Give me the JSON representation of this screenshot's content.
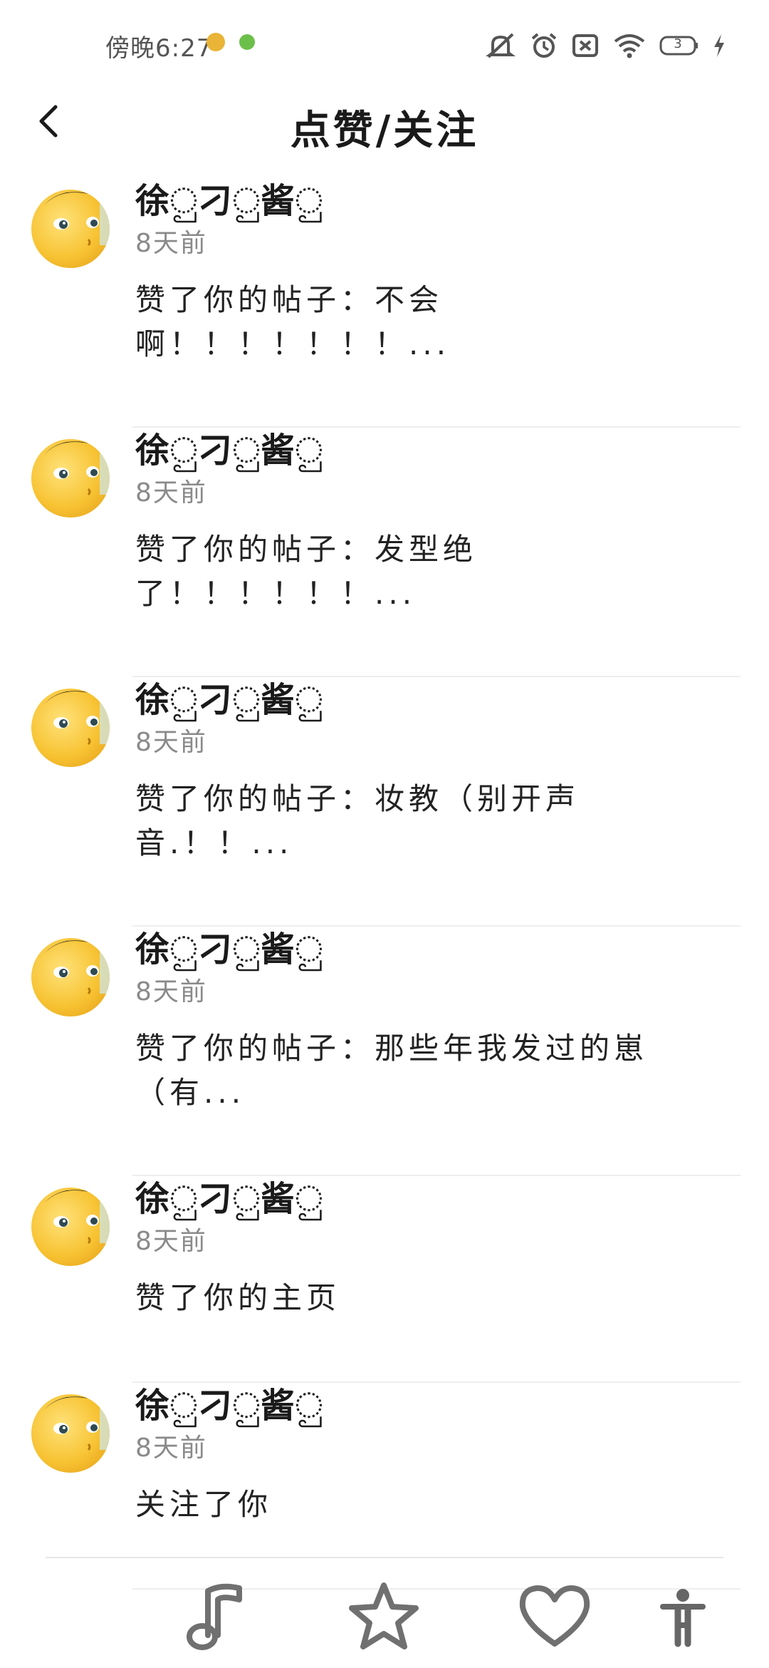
{
  "status_bar": {
    "time": "傍晚6:27",
    "app_icon_colors": [
      "#e9b437",
      "#6cc04a"
    ],
    "battery_level": "3",
    "icons": [
      "mute-icon",
      "alarm-icon",
      "sim-off-icon",
      "wifi-icon",
      "battery-icon",
      "charging-icon"
    ]
  },
  "header": {
    "title": "点赞/关注",
    "back_icon": "chevron-left-icon"
  },
  "notifications": [
    {
      "user": "徐ු刁ු酱ු",
      "time": "8天前",
      "message": "赞了你的帖子：不会啊！！！！！！！..."
    },
    {
      "user": "徐ු刁ු酱ු",
      "time": "8天前",
      "message": "赞了你的帖子：发型绝了！！！！！！..."
    },
    {
      "user": "徐ු刁ු酱ු",
      "time": "8天前",
      "message": "赞了你的帖子：妆教（别开声音.！！..."
    },
    {
      "user": "徐ු刁ු酱ු",
      "time": "8天前",
      "message": "赞了你的帖子：那些年我发过的崽（有..."
    },
    {
      "user": "徐ු刁ු酱ු",
      "time": "8天前",
      "message": "赞了你的主页"
    },
    {
      "user": "徐ු刁ු酱ු",
      "time": "8天前",
      "message": "关注了你"
    }
  ],
  "bottom_nav": {
    "icons": [
      "music-note-icon",
      "star-icon",
      "heart-icon",
      "accessibility-icon"
    ]
  },
  "colors": {
    "background": "#ffffff",
    "text_primary": "#1a1a1a",
    "text_secondary": "#8a8a8a",
    "divider": "#eeeeee",
    "avatar_yellow": "#f7c333"
  }
}
